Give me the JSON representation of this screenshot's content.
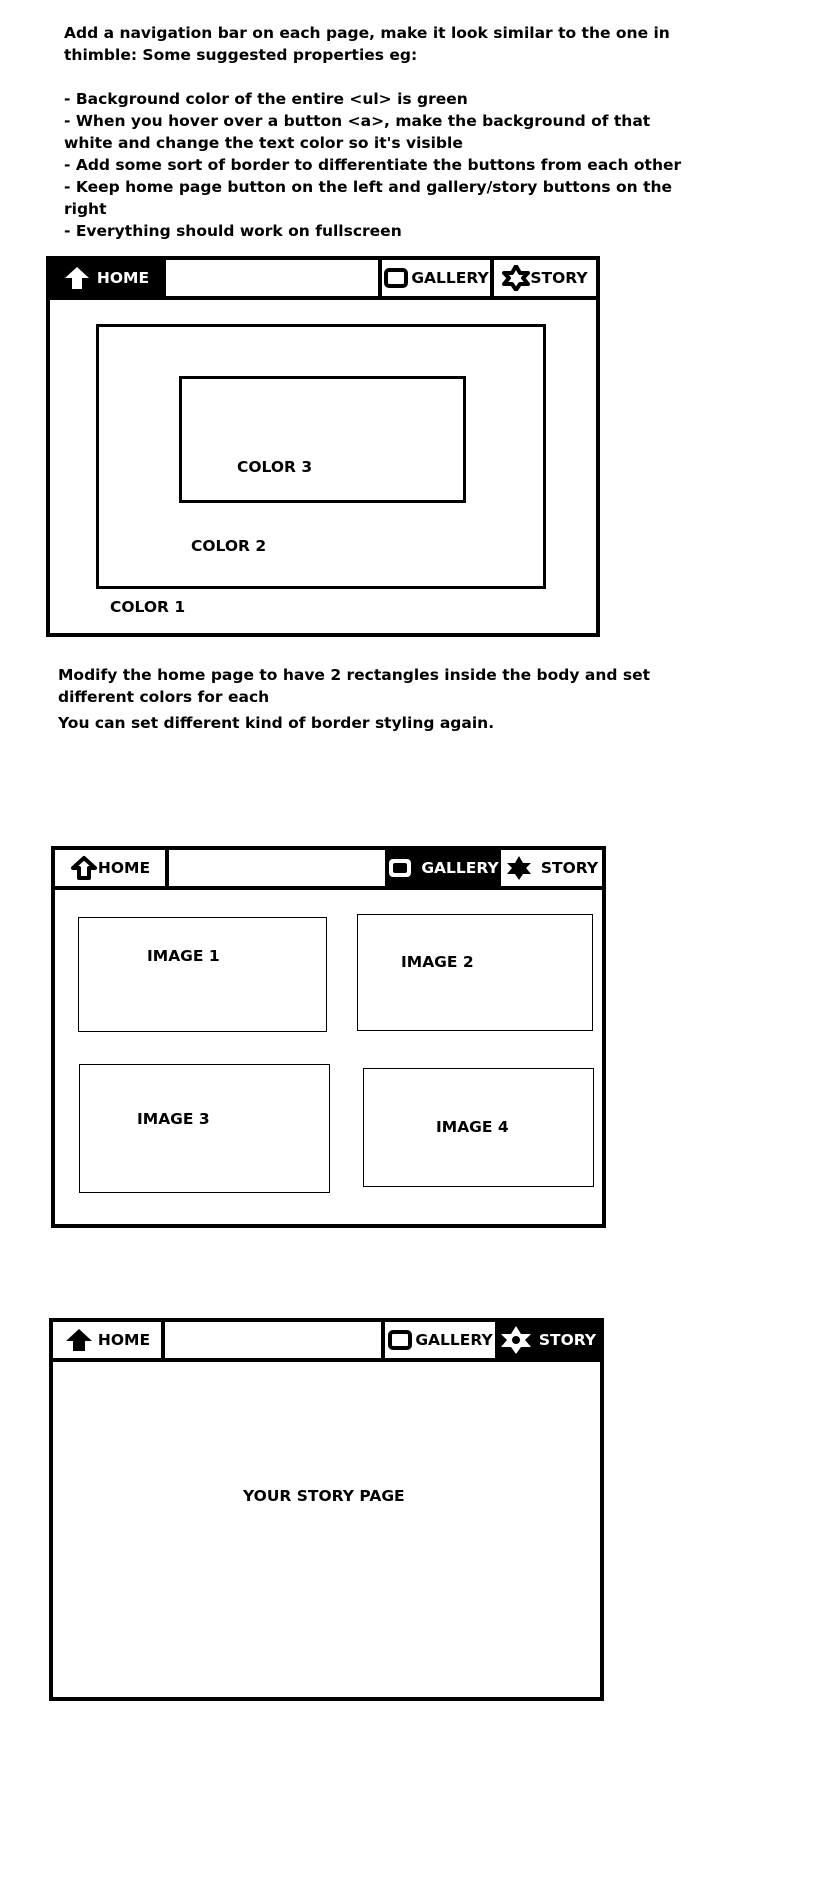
{
  "instructions": {
    "lines": [
      "Add a navigation bar on each page, make it look similar to the one in",
      "thimble: Some suggested properties eg:",
      "",
      "- Background color of the entire <ul> is green",
      "- When you hover over a button <a>, make the background of that",
      "white and change the text color so it's visible",
      "- Add some sort of border to differentiate the buttons from each other",
      "- Keep home page button on the left and gallery/story buttons on the",
      "right",
      "- Everything should work on fullscreen"
    ]
  },
  "nav": {
    "home": "HOME",
    "gallery": "GALLERY",
    "story": "STORY"
  },
  "home_page": {
    "color1": "COLOR 1",
    "color2": "COLOR 2",
    "color3": "COLOR 3"
  },
  "middle_text": {
    "line1": "Modify the home page to have 2 rectangles inside the body and set",
    "line2": "different colors for each",
    "line3": "You can set different kind of border styling again."
  },
  "gallery_page": {
    "image1": "IMAGE 1",
    "image2": "IMAGE 2",
    "image3": "IMAGE 3",
    "image4": "IMAGE 4"
  },
  "story_page": {
    "content": "YOUR STORY PAGE"
  },
  "colors": {
    "ink": "#000000",
    "paper": "#ffffff"
  }
}
